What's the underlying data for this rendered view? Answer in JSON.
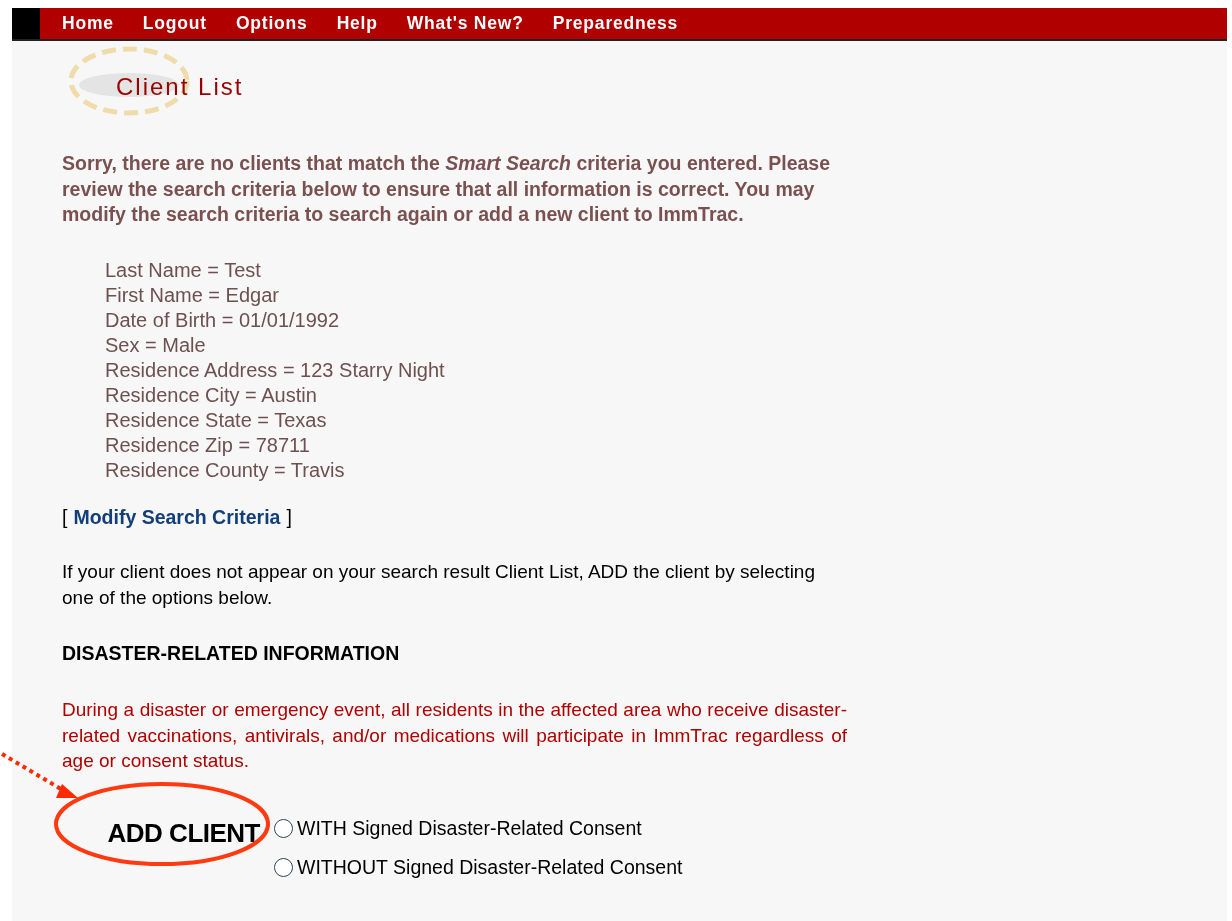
{
  "nav": [
    {
      "label": "Home"
    },
    {
      "label": "Logout"
    },
    {
      "label": "Options"
    },
    {
      "label": "Help"
    },
    {
      "label": "What's New?"
    },
    {
      "label": "Preparedness"
    }
  ],
  "page_title": "Client List",
  "message": "Sorry, there are no clients that match the *Smart Search* criteria you entered. Please review the search criteria below to ensure that all information is correct. You may modify the search criteria to search again or add a new client to ImmTrac.",
  "criteria": [
    "Last Name = Test",
    "First Name = Edgar",
    "Date of Birth = 01/01/1992",
    "Sex = Male",
    "Residence Address = 123 Starry Night",
    "Residence City = Austin",
    "Residence State = Texas",
    "Residence Zip = 78711",
    "Residence County = Travis"
  ],
  "modify_link": {
    "open": "[",
    "label": "Modify Search Criteria",
    "close": "]"
  },
  "instructions": "If your client does not appear on your search result Client List, ADD the client by selecting one of the options below.",
  "section_heading": "DISASTER-RELATED INFORMATION",
  "disaster_note": "During a disaster or emergency event, all residents in the affected area who receive disaster-related vaccinations, antivirals, and/or medications will participate in ImmTrac regardless of age or consent status.",
  "add_client_label": "ADD CLIENT",
  "options": [
    {
      "label": "WITH Signed Disaster-Related Consent",
      "selected": false
    },
    {
      "label": "WITHOUT Signed Disaster-Related Consent",
      "selected": false
    }
  ]
}
